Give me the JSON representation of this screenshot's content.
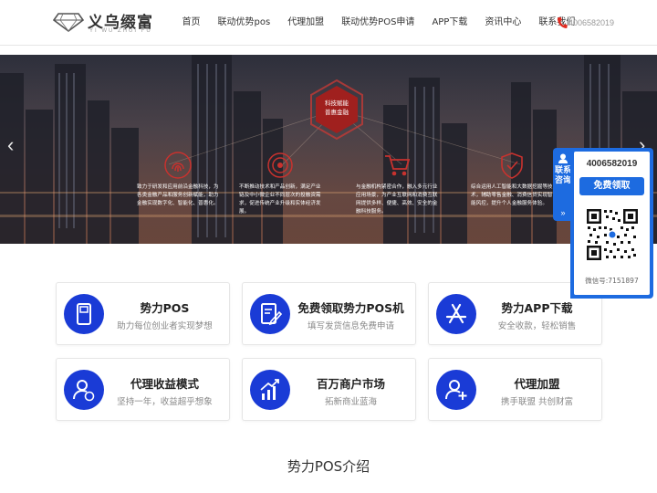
{
  "brand": {
    "name": "义乌缀富",
    "sub": "YI WU ZHUI FU"
  },
  "nav": {
    "items": [
      {
        "label": "首页"
      },
      {
        "label": "联动优势pos"
      },
      {
        "label": "代理加盟"
      },
      {
        "label": "联动优势POS申请"
      },
      {
        "label": "APP下载"
      },
      {
        "label": "资讯中心"
      },
      {
        "label": "联系我们"
      }
    ],
    "phone": "4006582019"
  },
  "banner": {
    "badge_line1": "科技赋能",
    "badge_line2": "普惠金融",
    "features": [
      {
        "icon": "fingerprint-icon",
        "text": "致力于研发和应用前沿金融科技，为各类金融产品和服务创新赋能，助力金融实现数字化、智能化、普惠化。"
      },
      {
        "icon": "target-icon",
        "text": "不断推动技术和产品创新，满足产业链及中小微企业不同层次的投融资需求，促进传统产业升级和实体经济发展。"
      },
      {
        "icon": "cart-icon",
        "text": "与金融机构紧密合作，融入多元行业应用场景，为产业互联网和消费互联网提供多样、便捷、高效、安全的金融科技服务。"
      },
      {
        "icon": "shield-icon",
        "text": "综合运用人工智能和大数据挖掘等技术，辅助零售金融、消费信贷实现智能风控，提升个人金融服务体验。"
      }
    ],
    "prev": "‹",
    "next": "›"
  },
  "cards": [
    {
      "icon": "pos-terminal-icon",
      "title": "势力POS",
      "sub": "助力每位创业者实现梦想"
    },
    {
      "icon": "form-edit-icon",
      "title": "免费领取势力POS机",
      "sub": "填写发货信息免费申请"
    },
    {
      "icon": "app-store-icon",
      "title": "势力APP下载",
      "sub": "安全收款，轻松销售"
    },
    {
      "icon": "agent-user-icon",
      "title": "代理收益模式",
      "sub": "坚持一年，收益超乎想象"
    },
    {
      "icon": "growth-chart-icon",
      "title": "百万商户市场",
      "sub": "拓新商业蓝海"
    },
    {
      "icon": "add-user-icon",
      "title": "代理加盟",
      "sub": "携手联盟 共创财富"
    }
  ],
  "section": {
    "title": "势力POS介绍"
  },
  "float": {
    "tab_text": "联系咨询",
    "tab_arrow": "»",
    "phone": "4006582019",
    "button": "免费领取",
    "wechat": "微信号:7151897"
  },
  "colors": {
    "accent": "#1a3bd6",
    "float_blue": "#1d6be0",
    "phone_red": "#e02b20"
  }
}
